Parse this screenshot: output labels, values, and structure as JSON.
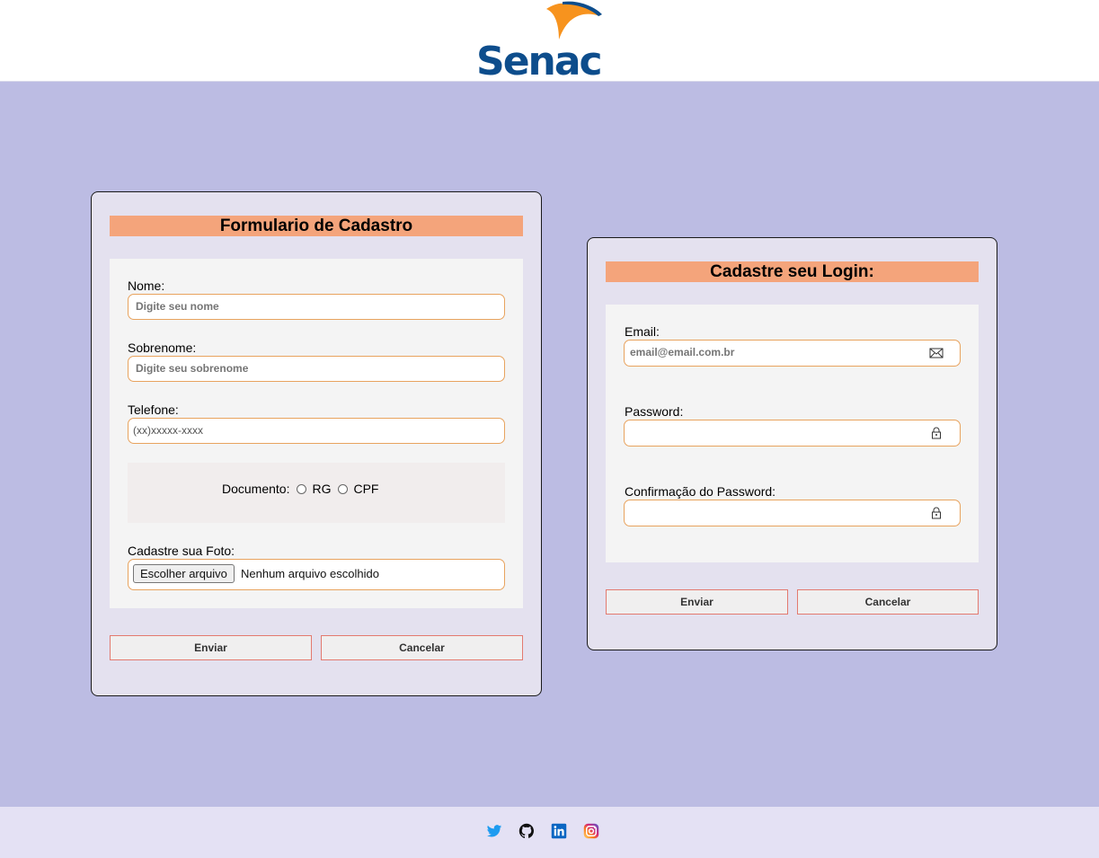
{
  "header": {
    "logo_text": "Senac"
  },
  "cadastro": {
    "title": "Formulario de Cadastro",
    "nome": {
      "label": "Nome:",
      "placeholder": "Digite seu nome"
    },
    "sobrenome": {
      "label": "Sobrenome:",
      "placeholder": "Digite seu sobrenome"
    },
    "telefone": {
      "label": "Telefone:",
      "placeholder": "(xx)xxxxx-xxxx"
    },
    "documento": {
      "label": "Documento:",
      "options": [
        "RG",
        "CPF"
      ]
    },
    "foto": {
      "label": "Cadastre sua Foto:",
      "button": "Escolher arquivo",
      "status": "Nenhum arquivo escolhido"
    },
    "enviar": "Enviar",
    "cancelar": "Cancelar"
  },
  "login": {
    "title": "Cadastre seu Login:",
    "email": {
      "label": "Email:",
      "placeholder": "email@email.com.br"
    },
    "password": {
      "label": "Password:"
    },
    "confirm": {
      "label": "Confirmação do Password:"
    },
    "enviar": "Enviar",
    "cancelar": "Cancelar"
  },
  "footer": {
    "icons": [
      "twitter-icon",
      "github-icon",
      "linkedin-icon",
      "instagram-icon"
    ]
  },
  "colors": {
    "background": "#bcbce3",
    "title_bar": "#f4a47b",
    "input_border": "#e8a35e",
    "button_border": "#e37a6f",
    "senac_blue": "#0d4d8c",
    "senac_orange": "#f7931e"
  }
}
